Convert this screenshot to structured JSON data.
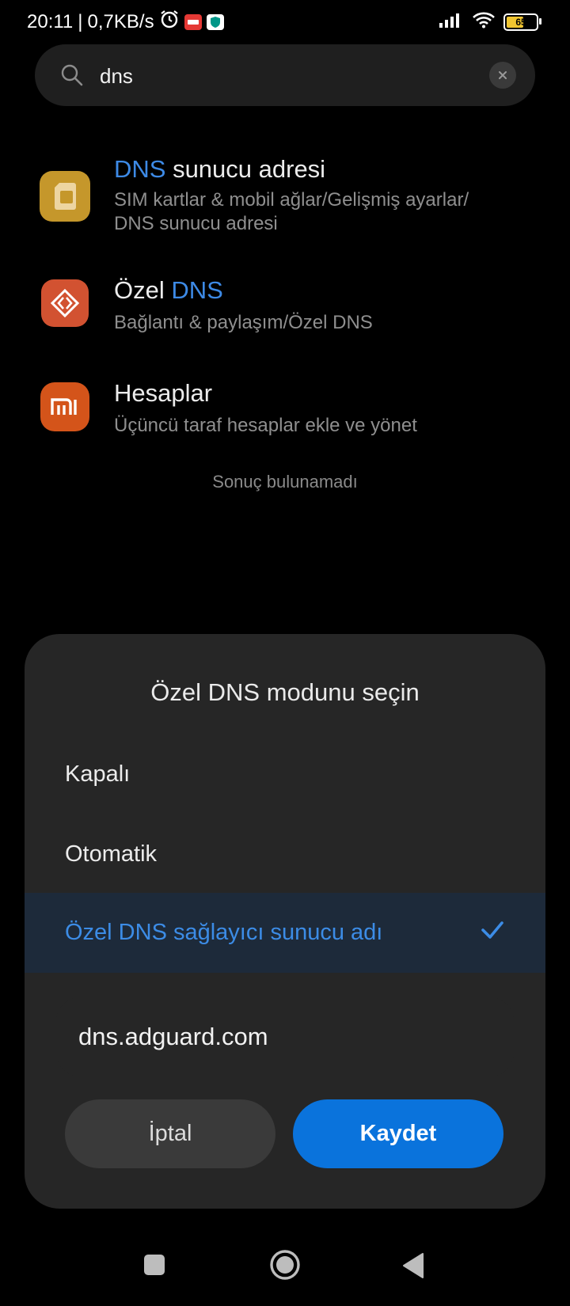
{
  "status_bar": {
    "time": "20:11",
    "separator": "|",
    "net_speed": "0,7KB/s",
    "battery_level": "65",
    "battery_fraction": 0.65,
    "badge_colors": {
      "red": "#e53935",
      "teal": "#009688",
      "battery": "#f0c531"
    }
  },
  "search": {
    "query": "dns",
    "icon": "search-icon",
    "clear_icon": "close-icon"
  },
  "results": [
    {
      "title_prefix": "DNS",
      "title_rest": " sunucu adresi",
      "path_line1": "SIM kartlar & mobil ağlar/Gelişmiş ayarlar/",
      "path_line2": "DNS sunucu adresi",
      "icon": "sim-card-icon",
      "icon_color": "#c5972b"
    },
    {
      "title_prefix": "Özel ",
      "title_rest": "DNS",
      "path": "Bağlantı & paylaşım/Özel DNS",
      "icon": "connection-sharing-icon",
      "icon_color": "#d25231"
    },
    {
      "title": "Hesaplar",
      "path": "Üçüncü taraf hesaplar ekle ve yönet",
      "icon": "mi-logo-icon",
      "icon_color": "#d4541a"
    }
  ],
  "no_result_text": "Sonuç bulunamadı",
  "dialog": {
    "title": "Özel DNS modunu seçin",
    "options": [
      "Kapalı",
      "Otomatik",
      "Özel DNS sağlayıcı sunucu adı"
    ],
    "selected_index": 2,
    "hostname_value": "dns.adguard.com",
    "cancel_label": "İptal",
    "save_label": "Kaydet",
    "accent": "#3c8ce6",
    "primary_button_color": "#0a73dc"
  },
  "nav": {
    "recents": "square-icon",
    "home": "circle-home-icon",
    "back": "back-triangle-icon"
  }
}
